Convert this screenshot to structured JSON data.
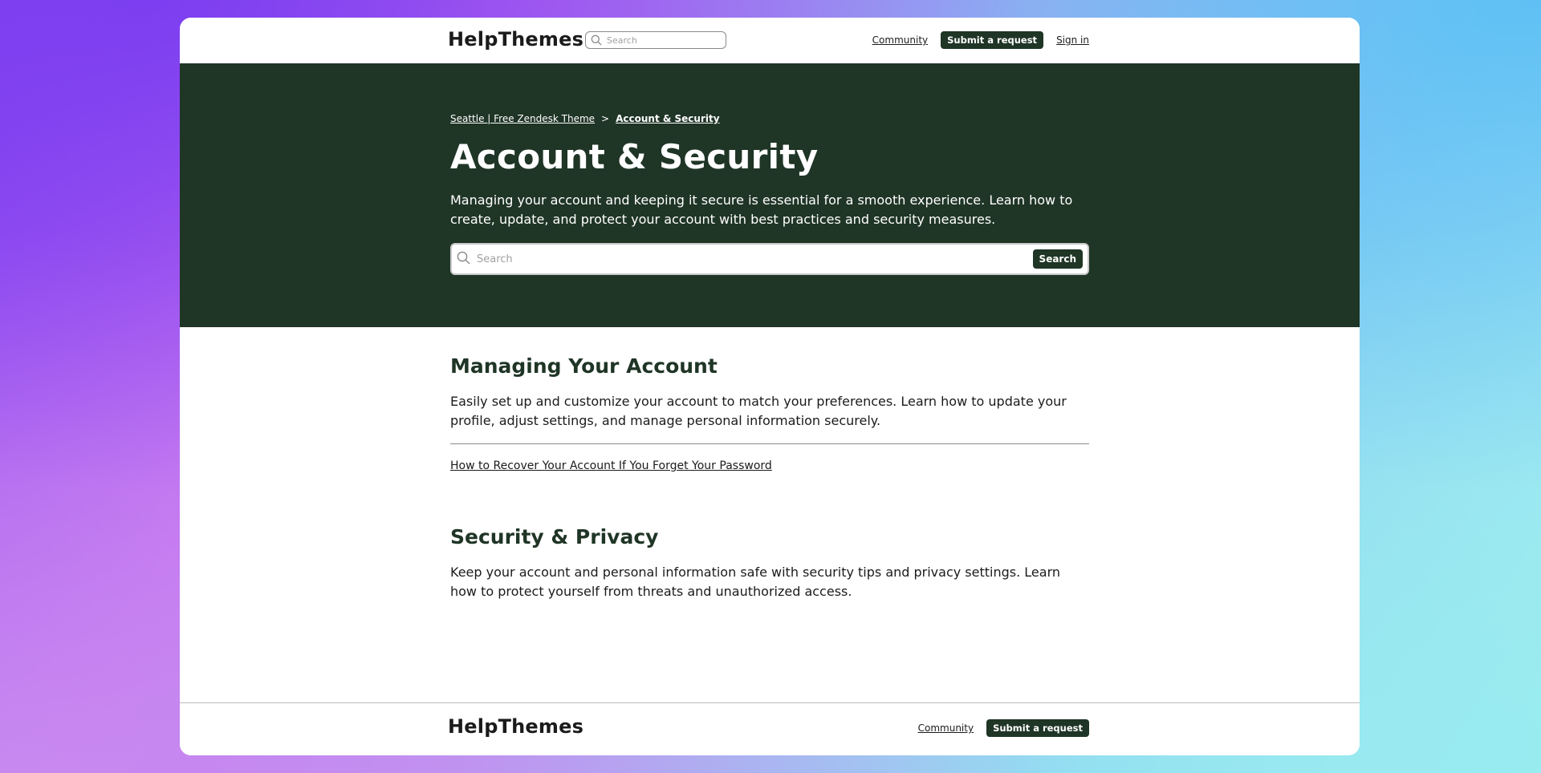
{
  "header": {
    "logo": "HelpThemes",
    "search_placeholder": "Search",
    "nav": {
      "community": "Community",
      "submit_request": "Submit a request",
      "sign_in": "Sign in"
    }
  },
  "hero": {
    "breadcrumb": {
      "home": "Seattle | Free Zendesk Theme",
      "separator": ">",
      "current": "Account & Security"
    },
    "title": "Account & Security",
    "description": "Managing your account and keeping it secure is essential for a smooth experience. Learn how to create, update, and protect your account with best practices and security measures.",
    "search": {
      "placeholder": "Search",
      "button": "Search"
    }
  },
  "sections": [
    {
      "title": "Managing Your Account",
      "description": "Easily set up and customize your account to match your preferences. Learn how to update your profile, adjust settings, and manage personal information securely.",
      "articles": [
        "How to Recover Your Account If You Forget Your Password"
      ]
    },
    {
      "title": "Security & Privacy",
      "description": "Keep your account and personal information safe with security tips and privacy settings. Learn how to protect yourself from threats and unauthorized access."
    }
  ],
  "footer": {
    "logo": "HelpThemes",
    "nav": {
      "community": "Community",
      "submit_request": "Submit a request"
    }
  },
  "colors": {
    "brand_dark": "#1f3526",
    "text": "#1b1b1b"
  },
  "icons": {
    "search": "search-icon"
  }
}
